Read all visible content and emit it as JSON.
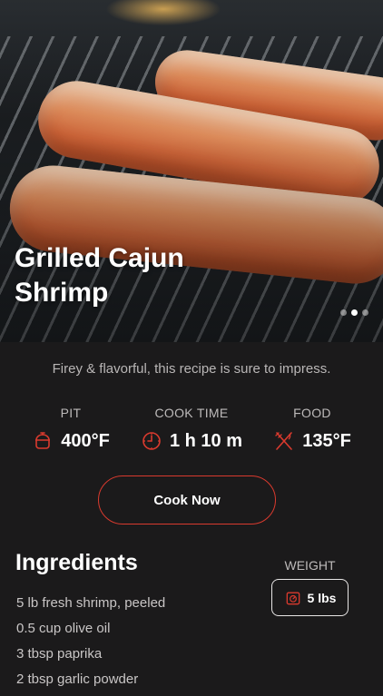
{
  "hero": {
    "title": "Grilled Cajun Shrimp",
    "carousel": {
      "total": 3,
      "active_index": 1
    }
  },
  "subtitle": "Firey & flavorful, this recipe is sure to impress.",
  "stats": [
    {
      "label": "PIT",
      "value": "400°F",
      "icon": "kamado-grill-icon"
    },
    {
      "label": "COOK TIME",
      "value": "1 h 10 m",
      "icon": "timer-icon"
    },
    {
      "label": "FOOD",
      "value": "135°F",
      "icon": "fork-knife-icon"
    }
  ],
  "cook_button": {
    "label": "Cook Now"
  },
  "ingredients": {
    "title": "Ingredients",
    "items": [
      "5 lb fresh shrimp, peeled",
      "0.5 cup olive oil",
      "3 tbsp paprika",
      "2 tbsp garlic powder"
    ]
  },
  "weight": {
    "label": "WEIGHT",
    "value": "5 lbs",
    "icon": "scale-icon"
  },
  "colors": {
    "accent": "#d93a2e",
    "background": "#1b1a1b",
    "text": "#ffffff",
    "muted": "#bdbaba"
  }
}
